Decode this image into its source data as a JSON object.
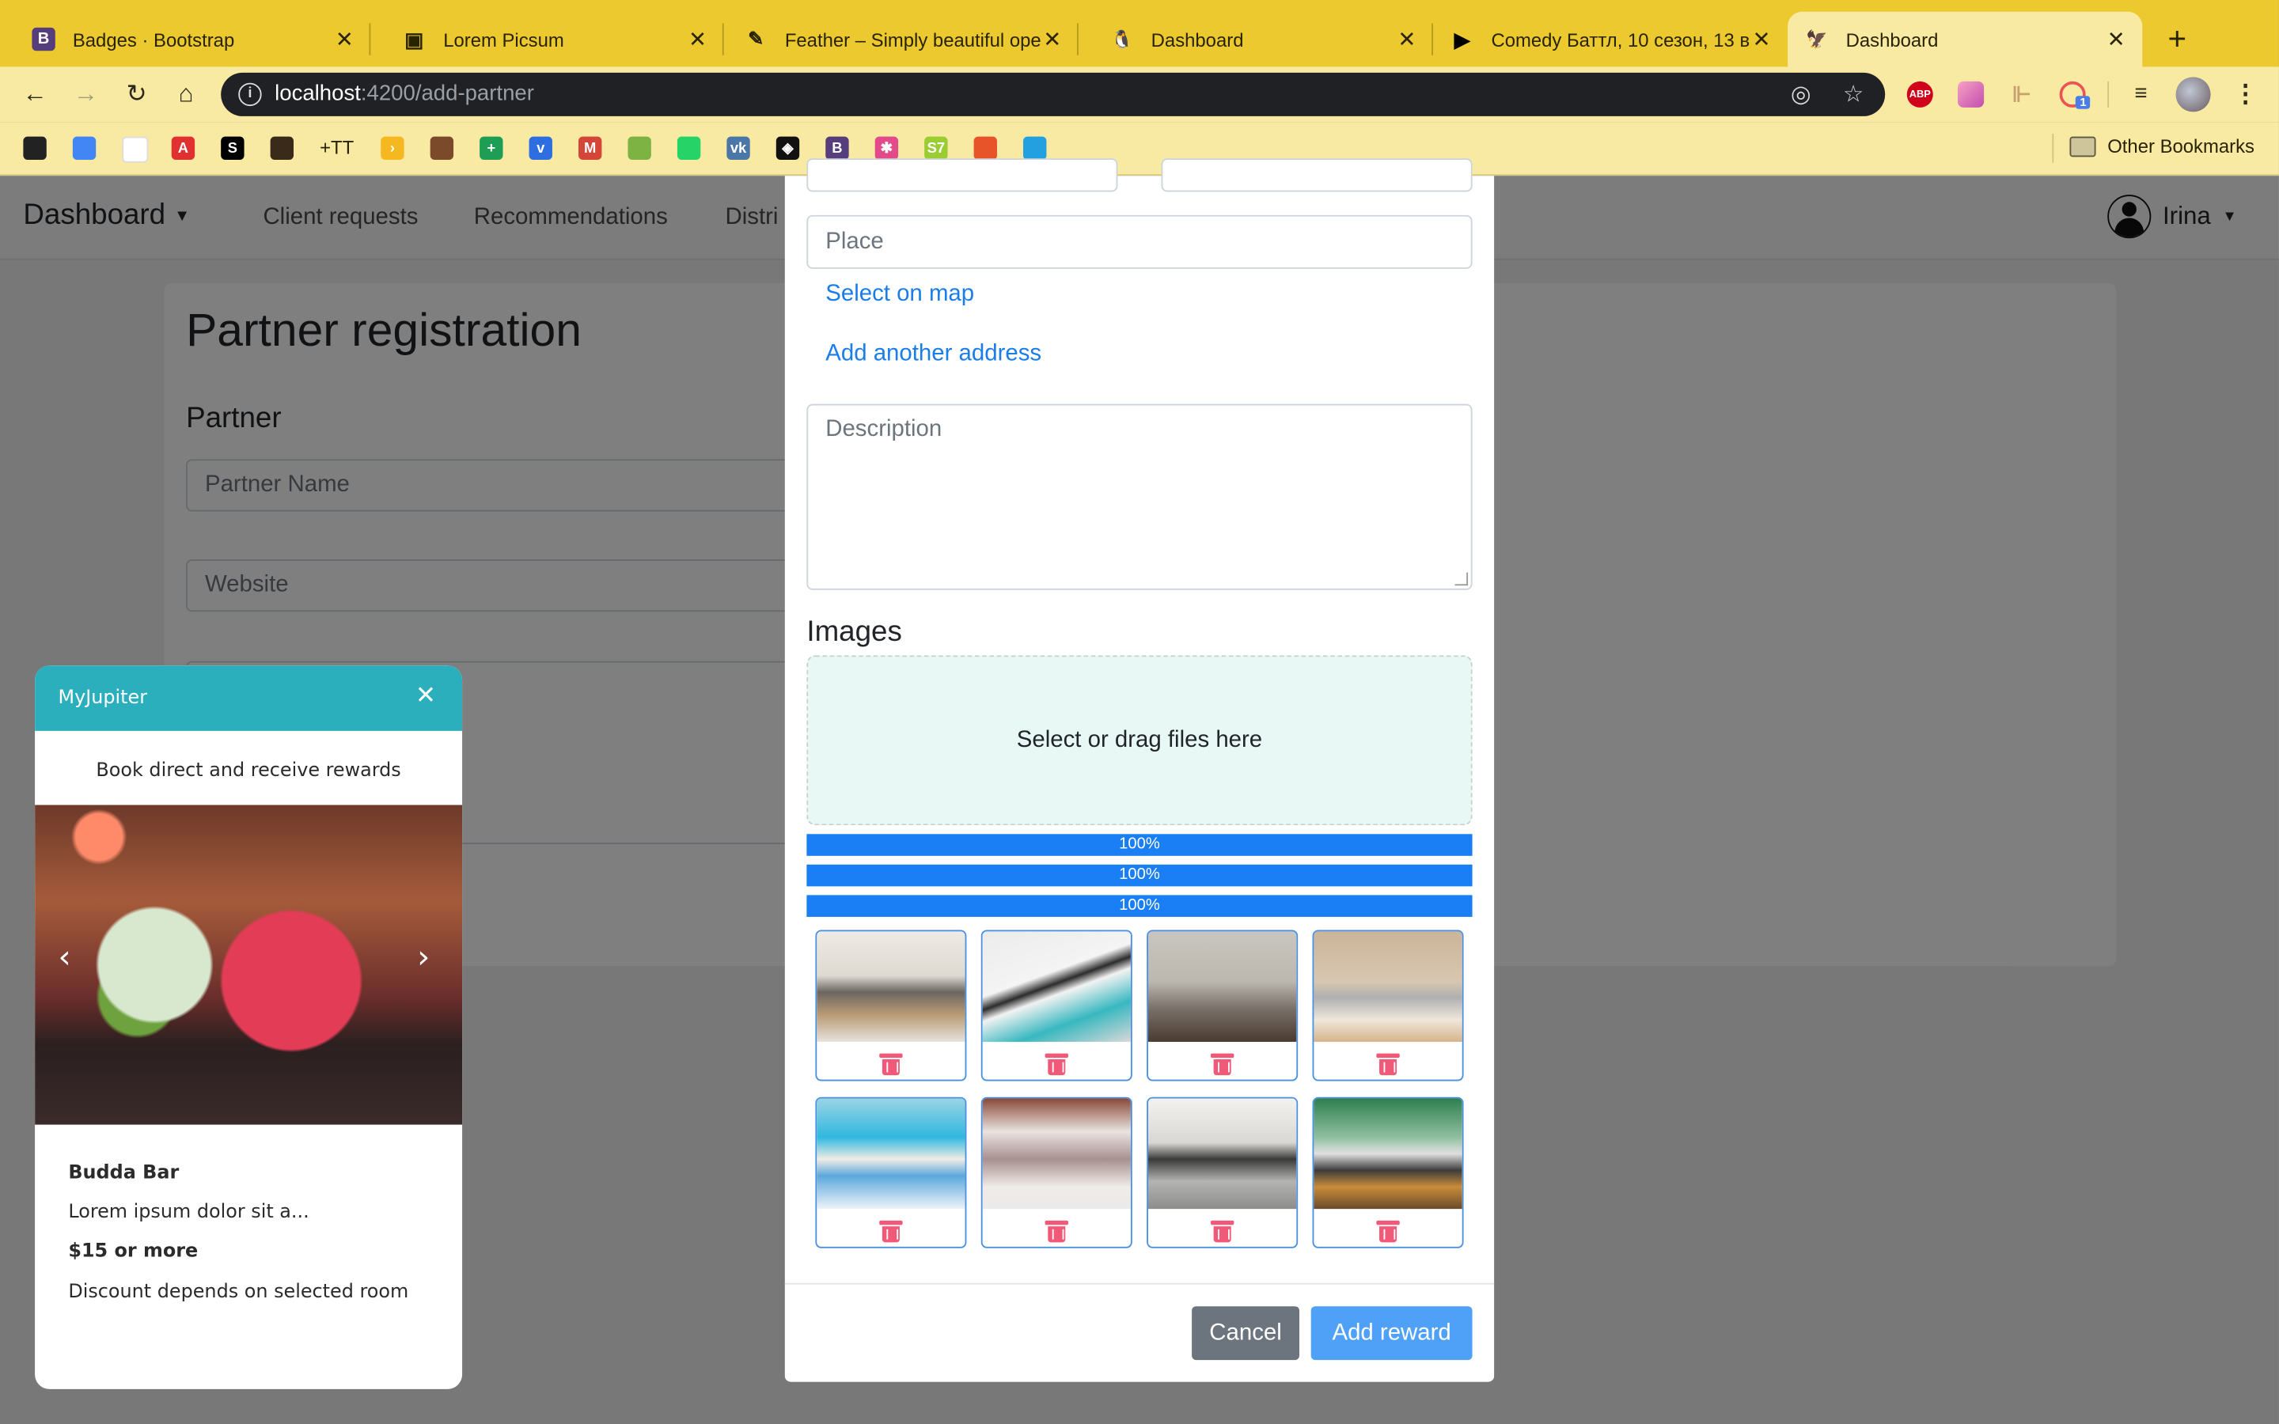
{
  "browser": {
    "tabs": [
      {
        "title": "Badges · Bootstrap",
        "favicon": "bootstrap-icon",
        "color": "#563d7c",
        "glyph": "B"
      },
      {
        "title": "Lorem Picsum",
        "favicon": "image-icon",
        "color": "#2a2300",
        "glyph": "▣"
      },
      {
        "title": "Feather – Simply beautiful ope",
        "favicon": "feather-icon",
        "color": "#2a2300",
        "glyph": "✎"
      },
      {
        "title": "Dashboard",
        "favicon": "penguin-icon",
        "color": "#f0a030",
        "glyph": "🐧"
      },
      {
        "title": "Comedy Баттл, 10 сезон, 13 в",
        "favicon": "play-icon",
        "color": "#000000",
        "glyph": "▶"
      },
      {
        "title": "Dashboard",
        "favicon": "eagle-icon",
        "color": "#7a4a2a",
        "glyph": "🦅",
        "active": true
      }
    ],
    "new_tab_label": "+",
    "close_glyph": "✕",
    "url_host": "localhost",
    "url_path": ":4200/add-partner",
    "extensions": [
      {
        "name": "adblock-icon",
        "label": "ABP",
        "color": "#d0021b"
      },
      {
        "name": "gradient-extension-icon",
        "label": "",
        "color": "#e35ba8"
      },
      {
        "name": "signpost-icon",
        "label": "",
        "color": "#c8a070"
      },
      {
        "name": "lastpass-icon",
        "label": "",
        "color": "#ea5455",
        "badge": "1"
      }
    ],
    "bookmarks": [
      {
        "name": "bookmark-1",
        "label": "",
        "color": "#222222"
      },
      {
        "name": "bookmark-2",
        "label": "",
        "color": "#4285f4"
      },
      {
        "name": "bookmark-3",
        "label": "",
        "color": "#ffffff"
      },
      {
        "name": "bookmark-4",
        "label": "A",
        "color": "#e03030"
      },
      {
        "name": "bookmark-5",
        "label": "S",
        "color": "#000000"
      },
      {
        "name": "bookmark-6",
        "label": "",
        "color": "#3a2a1a"
      },
      {
        "name": "bookmark-tt",
        "label": "+TT",
        "color": ""
      },
      {
        "name": "bookmark-8",
        "label": "›",
        "color": "#f5b820"
      },
      {
        "name": "bookmark-9",
        "label": "",
        "color": "#7a4a2a"
      },
      {
        "name": "bookmark-10",
        "label": "+",
        "color": "#1e9e55"
      },
      {
        "name": "bookmark-11",
        "label": "v",
        "color": "#2f6ee0"
      },
      {
        "name": "bookmark-gmail",
        "label": "M",
        "color": "#d44638"
      },
      {
        "name": "bookmark-13",
        "label": "",
        "color": "#7cb342"
      },
      {
        "name": "bookmark-whatsapp",
        "label": "",
        "color": "#25d366"
      },
      {
        "name": "bookmark-vk",
        "label": "vk",
        "color": "#4a76a8"
      },
      {
        "name": "bookmark-codepen",
        "label": "◈",
        "color": "#111111"
      },
      {
        "name": "bookmark-bootstrap",
        "label": "B",
        "color": "#563d7c"
      },
      {
        "name": "bookmark-18",
        "label": "✱",
        "color": "#e24a8a"
      },
      {
        "name": "bookmark-s7",
        "label": "S7",
        "color": "#9acd32"
      },
      {
        "name": "bookmark-20",
        "label": "",
        "color": "#e8542a"
      },
      {
        "name": "bookmark-21",
        "label": "",
        "color": "#22a0e0"
      }
    ],
    "other_bookmarks": "Other Bookmarks"
  },
  "app": {
    "brand": "Dashboard",
    "nav": [
      "Client requests",
      "Recommendations",
      "Distri"
    ],
    "user": "Irina",
    "page_title": "Partner registration",
    "section": "Partner",
    "partner_name_placeholder": "Partner Name",
    "website_placeholder": "Website"
  },
  "modal": {
    "place_placeholder": "Place",
    "select_on_map": "Select on map",
    "add_address": "Add another address",
    "description_placeholder": "Description",
    "images_label": "Images",
    "dropzone_text": "Select or drag files here",
    "uploads": [
      {
        "percent": 100,
        "label": "100%"
      },
      {
        "percent": 100,
        "label": "100%"
      },
      {
        "percent": 100,
        "label": "100%"
      }
    ],
    "thumbnails": [
      {
        "name": "living-room",
        "bg": "linear-gradient(180deg,#eeeae4 0%,#dedad2 40%,#6b6660 55%,#b89a74 75%,#e7e2dc 100%)"
      },
      {
        "name": "bedroom-teal",
        "bg": "linear-gradient(160deg,#ececec 0%,#f4f4f4 40%,#2c2c2c 48%,#f2f2f2 55%,#38b8c0 75%,#d8d8d8 100%)"
      },
      {
        "name": "bedroom-grey",
        "bg": "linear-gradient(180deg,#c9c6bf 0%,#bcb8b0 45%,#7a7068 70%,#4a3a30 100%)"
      },
      {
        "name": "bedroom-warm",
        "bg": "linear-gradient(180deg,#cbb49a 0%,#d8c7b0 45%,#b0b0b0 60%,#efe7dc 80%,#d6b48a 100%)"
      },
      {
        "name": "bedroom-seascape",
        "bg": "linear-gradient(180deg,#9ad4e4 0%,#30b8e0 35%,#f0ede6 55%,#5ba8dc 70%,#eef3f8 100%)"
      },
      {
        "name": "bedroom-wine",
        "bg": "linear-gradient(180deg,#8a4a3a 0%,#e9e3e0 30%,#a89090 55%,#f0ece8 80%,#eaeaea 100%)"
      },
      {
        "name": "studio-grey",
        "bg": "linear-gradient(180deg,#f2f2f0 0%,#d9d7d3 40%,#3a3a3a 55%,#b4b4b2 75%,#8c8c8a 100%)"
      },
      {
        "name": "lounge-tropical",
        "bg": "linear-gradient(180deg,#2f7f4f 0%,#8fbfa0 35%,#e0e0e0 50%,#3c3c3c 65%,#c98c3a 80%,#6a4a2a 100%)"
      }
    ],
    "cancel": "Cancel",
    "submit": "Add reward"
  },
  "widget": {
    "title": "MyJupiter",
    "tagline": "Book direct and receive rewards",
    "venue": "Budda Bar",
    "description": "Lorem ipsum dolor sit a...",
    "price": "$15 or more",
    "note": "Discount depends on selected room",
    "prev": "‹",
    "next": "›",
    "close": "✕"
  },
  "colors": {
    "tab_strip": "#ecca2f",
    "toolbar": "#f8eaa3",
    "link": "#1a7de8",
    "progress": "#1a7ff5",
    "cancel_btn": "#6c757d",
    "submit_btn": "#4ea1f7",
    "widget_header": "#2cafbd",
    "trash": "#f05a78"
  }
}
